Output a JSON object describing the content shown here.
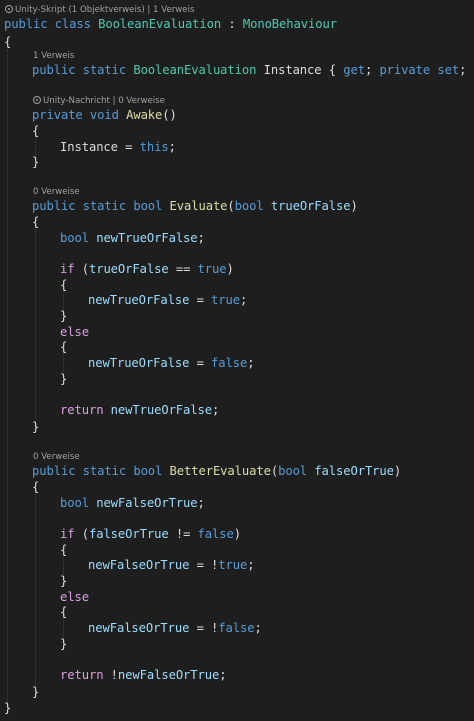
{
  "lenses": {
    "class": {
      "icon": "unity-icon",
      "text": "Unity-Skript (1 Objektverweis) | 1 Verweis"
    },
    "instance": "1 Verweis",
    "awake": {
      "icon": "unity-icon",
      "text": "Unity-Nachricht | 0 Verweise"
    },
    "evaluate": "0 Verweise",
    "better_evaluate": "0 Verweise"
  },
  "code": {
    "class_decl": {
      "kw": "public class ",
      "name": "BooleanEvaluation",
      "sep": " : ",
      "base": "MonoBehaviour"
    },
    "open_brace": "{",
    "close_brace": "}",
    "instance_decl": {
      "kw": "public static ",
      "type": "BooleanEvaluation",
      "name": " Instance { ",
      "get": "get",
      "semi1": "; ",
      "private": "private",
      "set": " set",
      "tail": "; }"
    },
    "awake_decl": {
      "kw": "private void ",
      "name": "Awake",
      "tail": "()"
    },
    "instance_assign": {
      "lhs": "Instance",
      "op": " = ",
      "rhs": "this",
      "semi": ";"
    },
    "evaluate_decl": {
      "kw": "public static bool ",
      "name": "Evaluate",
      "open": "(",
      "ptype": "bool",
      "pname": " trueOrFalse",
      "close": ")"
    },
    "eval_var_decl": {
      "kw": "bool ",
      "name": "newTrueOrFalse",
      "semi": ";"
    },
    "eval_if": {
      "kw": "if",
      "open": " (",
      "var": "trueOrFalse",
      "op": " == ",
      "val": "true",
      "close": ")"
    },
    "eval_assign_true": {
      "var": "newTrueOrFalse",
      "op": " = ",
      "val": "true",
      "semi": ";"
    },
    "else_kw": "else",
    "eval_assign_false": {
      "var": "newTrueOrFalse",
      "op": " = ",
      "val": "false",
      "semi": ";"
    },
    "eval_return": {
      "kw": "return ",
      "var": "newTrueOrFalse",
      "semi": ";"
    },
    "better_decl": {
      "kw": "public static bool ",
      "name": "BetterEvaluate",
      "open": "(",
      "ptype": "bool",
      "pname": " falseOrTrue",
      "close": ")"
    },
    "better_var_decl": {
      "kw": "bool ",
      "name": "newFalseOrTrue",
      "semi": ";"
    },
    "better_if": {
      "kw": "if",
      "open": " (",
      "var": "falseOrTrue",
      "op": " != ",
      "val": "false",
      "close": ")"
    },
    "better_assign_1": {
      "var": "newFalseOrTrue",
      "op": " = !",
      "val": "true",
      "semi": ";"
    },
    "better_assign_2": {
      "var": "newFalseOrTrue",
      "op": " = !",
      "val": "false",
      "semi": ";"
    },
    "better_return": {
      "kw": "return",
      "op": " !",
      "var": "newFalseOrTrue",
      "semi": ";"
    }
  },
  "colors": {
    "background": "#1e1e1e",
    "keyword": "#569cd6",
    "type": "#4ec9b0",
    "method": "#dcdcaa",
    "variable": "#9cdcfe",
    "control": "#d8a0df",
    "text": "#dcdcdc"
  }
}
